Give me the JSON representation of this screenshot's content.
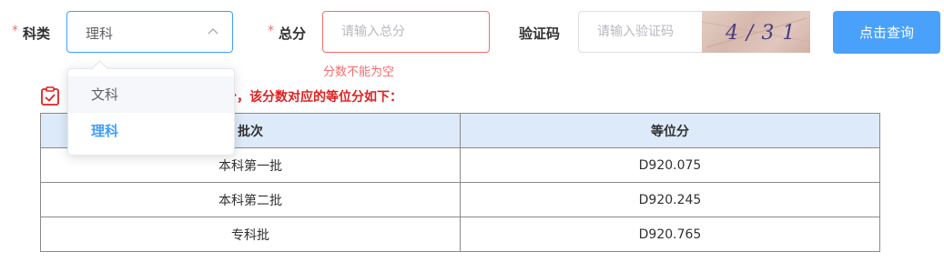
{
  "form": {
    "required_mark": "*",
    "subject_label": "科类",
    "subject_value": "理科",
    "score_label": "总分",
    "score_placeholder": "请输入总分",
    "score_error": "分数不能为空",
    "captcha_label": "验证码",
    "captcha_placeholder": "请输入验证码",
    "captcha_text": "4/31",
    "query_button": "点击查询"
  },
  "dropdown": {
    "options": [
      "文科",
      "理科"
    ],
    "selected": "理科"
  },
  "result": {
    "partial_text": "分，该分数对应的等位分如下：",
    "columns": [
      "批次",
      "等位分"
    ],
    "rows": [
      [
        "本科第一批",
        "D920.075"
      ],
      [
        "本科第二批",
        "D920.245"
      ],
      [
        "专科批",
        "D920.765"
      ]
    ]
  },
  "colors": {
    "primary": "#409eff",
    "error": "#f56c6c",
    "result_text": "#e02020",
    "header_bg": "#ddeaf9"
  }
}
